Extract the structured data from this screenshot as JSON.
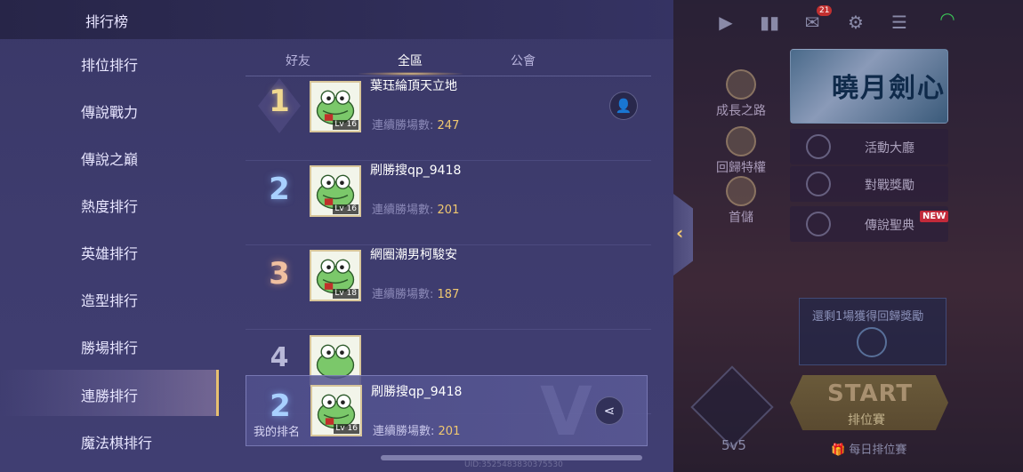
{
  "header": {
    "title": "排行榜"
  },
  "nav": {
    "items": [
      {
        "label": "排位排行",
        "active": false
      },
      {
        "label": "傳說戰力",
        "active": false
      },
      {
        "label": "傳說之巔",
        "active": false
      },
      {
        "label": "熱度排行",
        "active": false
      },
      {
        "label": "英雄排行",
        "active": false
      },
      {
        "label": "造型排行",
        "active": false
      },
      {
        "label": "勝場排行",
        "active": false
      },
      {
        "label": "連勝排行",
        "active": true
      },
      {
        "label": "魔法棋排行",
        "active": false
      }
    ]
  },
  "tabs": [
    {
      "label": "好友",
      "active": false
    },
    {
      "label": "全區",
      "active": true
    },
    {
      "label": "公會",
      "active": false
    }
  ],
  "list": {
    "rows": [
      {
        "rank": "1",
        "name": "葉珏綸頂天立地",
        "stat_label": "連續勝場數:",
        "stat_value": "247",
        "level": "Lv 16",
        "action_icon": "add-friend-icon"
      },
      {
        "rank": "2",
        "name": "刷勝搜qp_9418",
        "stat_label": "連續勝場數:",
        "stat_value": "201",
        "level": "Lv 16"
      },
      {
        "rank": "3",
        "name": "網圈潮男柯駿安",
        "stat_label": "連續勝場數:",
        "stat_value": "187",
        "level": "Lv 18"
      },
      {
        "rank": "4",
        "name": "",
        "stat_label": "",
        "stat_value": "",
        "level": ""
      }
    ]
  },
  "my_rank": {
    "rank": "2",
    "label": "我的排名",
    "name": "刷勝搜qp_9418",
    "stat_label": "連續勝場數:",
    "stat_value": "201",
    "level": "Lv 16",
    "action_icon": "share-icon"
  },
  "background": {
    "mail_badge": "21",
    "side_buttons": [
      "成長之路",
      "回歸特權",
      "首儲"
    ],
    "banner_text": "曉月劍心",
    "event_buttons": [
      "活動大廳",
      "對戰獎勵",
      "傳說聖典"
    ],
    "new_tag": "NEW",
    "reward_text": "還剩1場獲得回歸獎勵",
    "mode_label": "5v5",
    "start_label": "START",
    "start_sub": "排位賽",
    "daily_label": "每日排位賽"
  },
  "footer": {
    "uid": "UID:3525483830375530"
  },
  "colors": {
    "accent_gold": "#f0c870",
    "panel": "#3e3c6e",
    "nav_highlight": "#e8c070"
  }
}
